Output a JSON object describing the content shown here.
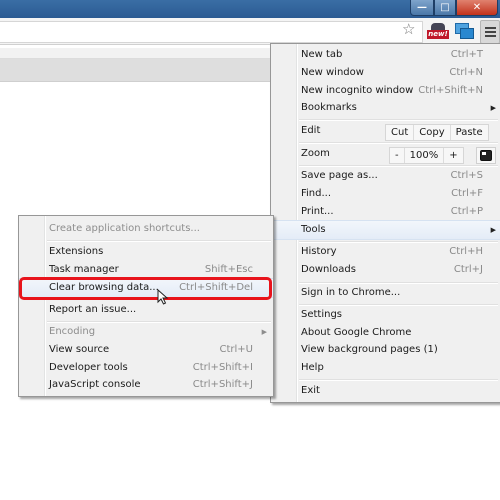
{
  "window": {
    "controls": {
      "minimize": "—",
      "maximize": "□",
      "close": "✕"
    }
  },
  "toolbar": {
    "bookmark_star": "☆",
    "extension_badge": "new!",
    "icons": [
      "star-icon",
      "extension-new-icon",
      "extension-windows-icon",
      "chrome-menu-icon"
    ]
  },
  "main_menu": {
    "items": [
      {
        "label": "New tab",
        "shortcut": "Ctrl+T"
      },
      {
        "label": "New window",
        "shortcut": "Ctrl+N"
      },
      {
        "label": "New incognito window",
        "shortcut": "Ctrl+Shift+N"
      },
      {
        "label": "Bookmarks",
        "shortcut": "",
        "submenu": true
      },
      {
        "label": "Edit",
        "buttons": [
          "Cut",
          "Copy",
          "Paste"
        ]
      },
      {
        "label": "Zoom",
        "zoom_minus": "-",
        "zoom_value": "100%",
        "zoom_plus": "+"
      },
      {
        "label": "Save page as...",
        "shortcut": "Ctrl+S"
      },
      {
        "label": "Find...",
        "shortcut": "Ctrl+F"
      },
      {
        "label": "Print...",
        "shortcut": "Ctrl+P"
      },
      {
        "label": "Tools",
        "shortcut": "",
        "submenu": true,
        "highlighted": true
      },
      {
        "label": "History",
        "shortcut": "Ctrl+H"
      },
      {
        "label": "Downloads",
        "shortcut": "Ctrl+J"
      },
      {
        "label": "Sign in to Chrome...",
        "shortcut": ""
      },
      {
        "label": "Settings",
        "shortcut": ""
      },
      {
        "label": "About Google Chrome",
        "shortcut": ""
      },
      {
        "label": "View background pages (1)",
        "shortcut": ""
      },
      {
        "label": "Help",
        "shortcut": ""
      },
      {
        "label": "Exit",
        "shortcut": ""
      }
    ]
  },
  "tools_submenu": {
    "items": [
      {
        "label": "Create application shortcuts...",
        "shortcut": "",
        "disabled": true
      },
      {
        "label": "Extensions",
        "shortcut": ""
      },
      {
        "label": "Task manager",
        "shortcut": "Shift+Esc"
      },
      {
        "label": "Clear browsing data...",
        "shortcut": "Ctrl+Shift+Del",
        "highlighted": true
      },
      {
        "label": "Report an issue...",
        "shortcut": ""
      },
      {
        "label": "Encoding",
        "shortcut": "",
        "disabled": true,
        "submenu": true
      },
      {
        "label": "View source",
        "shortcut": "Ctrl+U"
      },
      {
        "label": "Developer tools",
        "shortcut": "Ctrl+Shift+I"
      },
      {
        "label": "JavaScript console",
        "shortcut": "Ctrl+Shift+J"
      }
    ]
  },
  "annotation": {
    "highlight_color": "#e8141c"
  },
  "glyphs": {
    "submenu_arrow": "▶"
  }
}
